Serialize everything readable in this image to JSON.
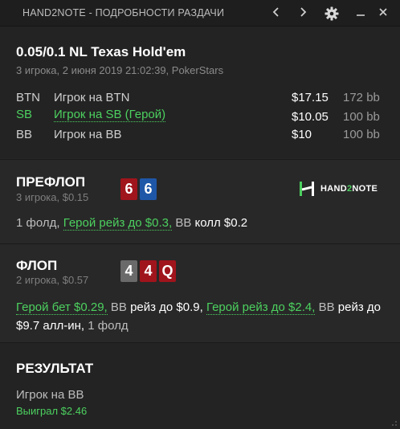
{
  "window": {
    "title": "HAND2NOTE - ПОДРОБНОСТИ РАЗДАЧИ"
  },
  "hand": {
    "game": "0.05/0.1 NL Texas Hold'em",
    "subtitle": "3 игрока, 2 июня 2019 21:02:39, PokerStars",
    "players": [
      {
        "pos": "BTN",
        "name": "Игрок на BTN",
        "stack": "$17.15",
        "bb": "172 bb",
        "hero": false
      },
      {
        "pos": "SB",
        "name": "Игрок на SB (Герой)",
        "stack": "$10.05",
        "bb": "100 bb",
        "hero": true
      },
      {
        "pos": "BB",
        "name": "Игрок на BB",
        "stack": "$10",
        "bb": "100 bb",
        "hero": false
      }
    ]
  },
  "preflop": {
    "title": "ПРЕФЛОП",
    "sub": "3 игрока, $0.15",
    "cards": [
      {
        "rank": "6",
        "suit": "hearts",
        "color": "#a0141c"
      },
      {
        "rank": "6",
        "suit": "diamonds",
        "color": "#1e57a8"
      }
    ],
    "actions": {
      "fold": "1 фолд,",
      "hero": "Герой рейз до $0.3,",
      "player": "BB",
      "act": "колл $0.2"
    }
  },
  "logo": {
    "part1": "HAND",
    "part2": "2",
    "part3": "NOTE"
  },
  "flop": {
    "title": "ФЛОП",
    "sub": "2 игрока, $0.57",
    "cards": [
      {
        "rank": "4",
        "color": "#6a6a6a"
      },
      {
        "rank": "4",
        "color": "#a0141c"
      },
      {
        "rank": "Q",
        "color": "#a0141c"
      }
    ],
    "actions": {
      "hero1": "Герой бет $0.29,",
      "player1": "BB",
      "act1": "рейз до $0.9,",
      "hero2": "Герой рейз до $2.4,",
      "player2": "BB",
      "act2": "рейз до $9.7 алл-ин,",
      "fold": "1 фолд"
    }
  },
  "result": {
    "title": "РЕЗУЛЬТАТ",
    "player": "Игрок на BB",
    "won": "Выиграл $2.46"
  },
  "colors": {
    "hero": "#4cd15f",
    "red_card": "#a0141c",
    "blue_card": "#1e57a8",
    "grey_card": "#6a6a6a"
  }
}
